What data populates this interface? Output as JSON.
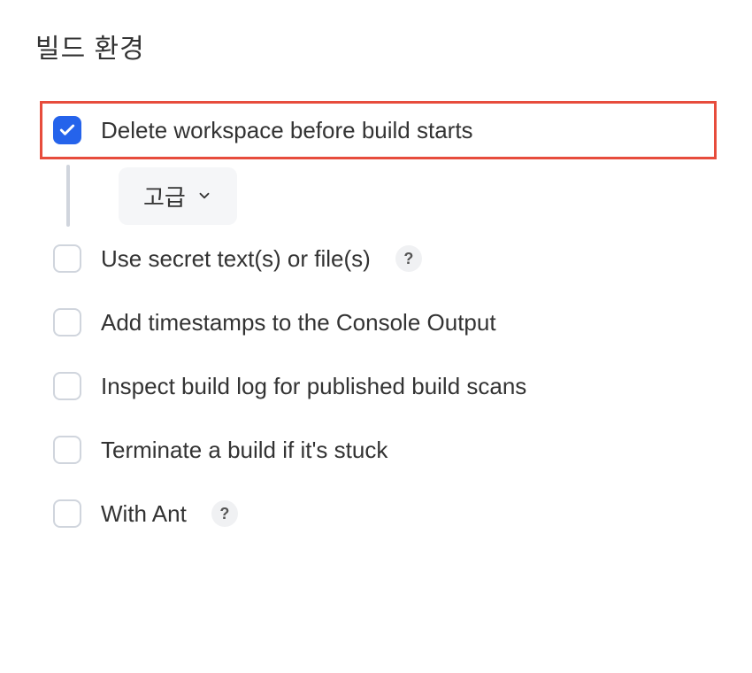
{
  "section": {
    "title": "빌드 환경"
  },
  "options": {
    "delete_workspace": {
      "label": "Delete workspace before build starts",
      "checked": true,
      "highlighted": true,
      "has_help": false
    },
    "advanced": {
      "label": "고급"
    },
    "use_secret": {
      "label": "Use secret text(s) or file(s)",
      "checked": false,
      "has_help": true
    },
    "add_timestamps": {
      "label": "Add timestamps to the Console Output",
      "checked": false,
      "has_help": false
    },
    "inspect_build_log": {
      "label": "Inspect build log for published build scans",
      "checked": false,
      "has_help": false
    },
    "terminate_stuck": {
      "label": "Terminate a build if it's stuck",
      "checked": false,
      "has_help": false
    },
    "with_ant": {
      "label": "With Ant",
      "checked": false,
      "has_help": true
    }
  },
  "help_tooltip": "?"
}
